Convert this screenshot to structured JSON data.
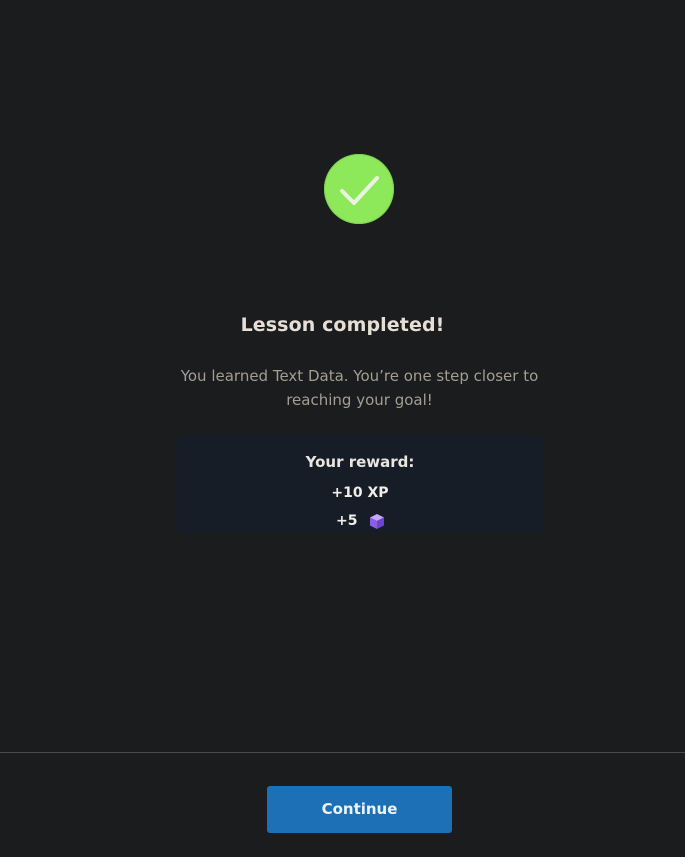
{
  "completion": {
    "icon": "checkmark-icon",
    "title": "Lesson completed!",
    "message": "You learned Text Data. You’re one step closer to reaching your goal!"
  },
  "reward": {
    "label": "Your reward:",
    "xp": "+10 XP",
    "gems": "+5",
    "gem_icon": "gem-icon"
  },
  "footer": {
    "continue_label": "Continue"
  },
  "colors": {
    "background": "#1b1c1e",
    "success": "#8de85a",
    "reward_panel": "#171d26",
    "button": "#1e70b6",
    "gem": "#9b6cf0"
  }
}
